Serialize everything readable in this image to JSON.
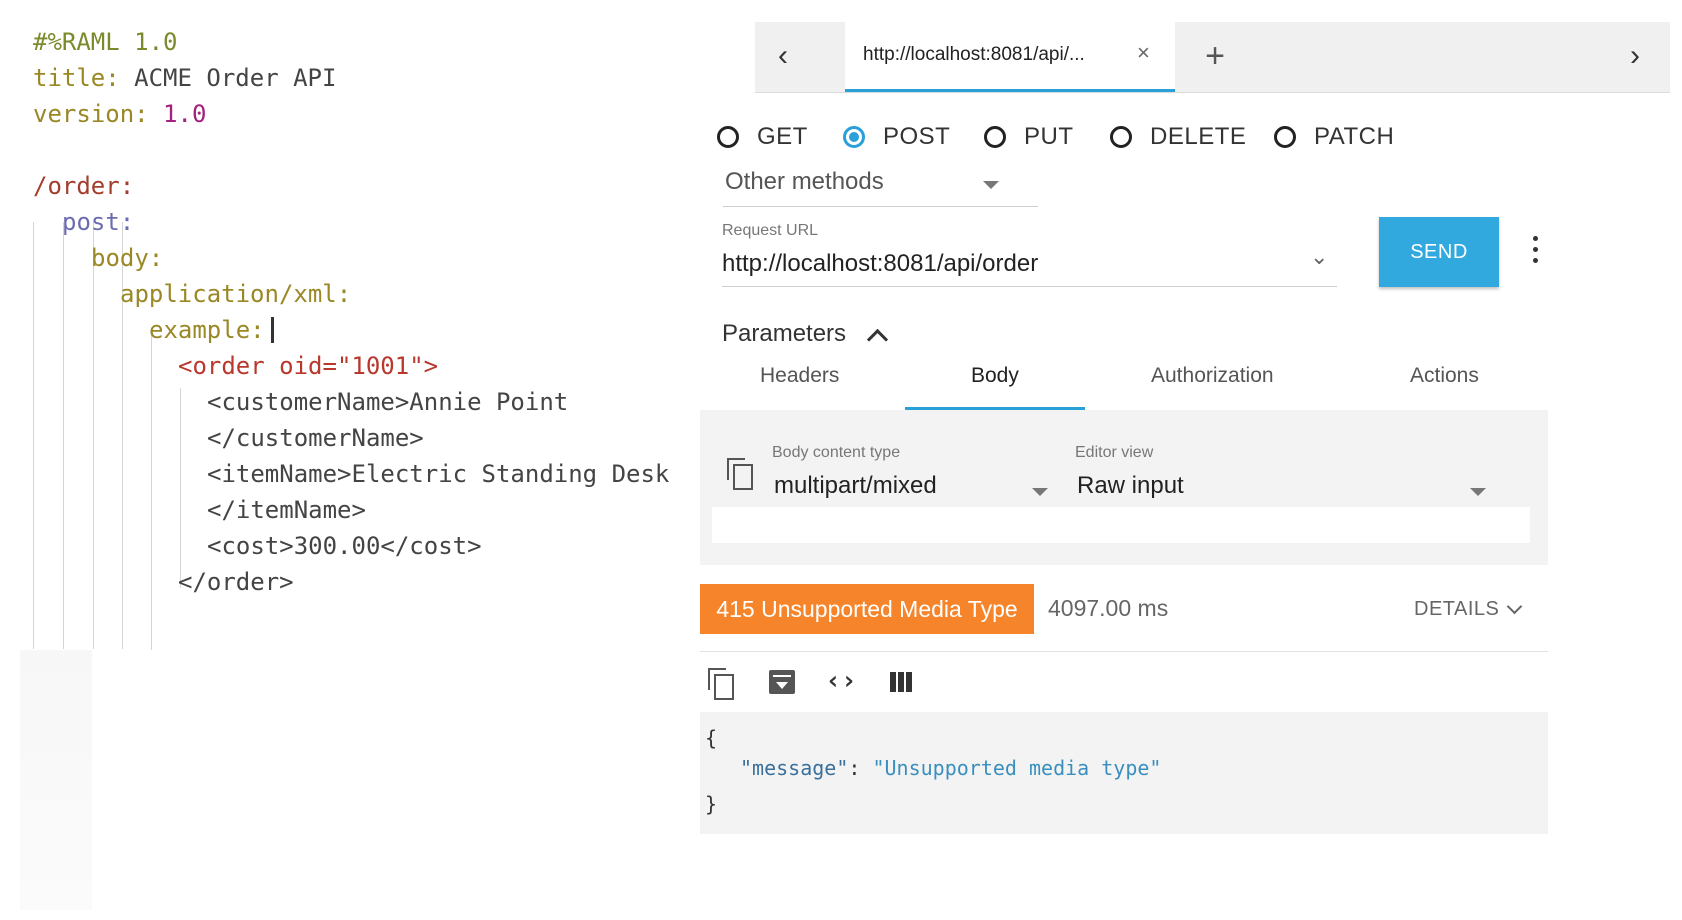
{
  "editor": {
    "header": {
      "raml": "#%RAML 1.0",
      "title_key": "title:",
      "title_val": "ACME Order API",
      "version_key": "version:",
      "version_val": "1.0"
    },
    "resource": "/order:",
    "method": "post:",
    "body_key": "body:",
    "media_type": "application/xml:",
    "example_key": "example:",
    "xml": {
      "order_open": "<order oid=\"1001\">",
      "customer_open": "<customerName>Annie Point",
      "customer_close": "</customerName>",
      "item_open": "<itemName>Electric Standing Desk",
      "item_close": "</itemName>",
      "cost": "<cost>300.00</cost>",
      "order_close": "</order>"
    }
  },
  "console": {
    "tab": {
      "title": "http://localhost:8081/api/...",
      "close": "×"
    },
    "nav": {
      "back": "‹",
      "forward": "›",
      "add": "+"
    },
    "methods": [
      {
        "label": "GET",
        "selected": false
      },
      {
        "label": "POST",
        "selected": true
      },
      {
        "label": "PUT",
        "selected": false
      },
      {
        "label": "DELETE",
        "selected": false
      },
      {
        "label": "PATCH",
        "selected": false
      }
    ],
    "other_methods": "Other methods",
    "request_url_label": "Request URL",
    "request_url": "http://localhost:8081/api/order",
    "send_label": "SEND",
    "parameters_label": "Parameters",
    "subtabs": [
      "Headers",
      "Body",
      "Authorization",
      "Actions"
    ],
    "active_subtab": "Body",
    "body_content_type_label": "Body content type",
    "body_content_type": "multipart/mixed",
    "editor_view_label": "Editor view",
    "editor_view": "Raw input",
    "response": {
      "status": "415 Unsupported Media Type",
      "time": "4097.00 ms",
      "details": "DETAILS",
      "status_color": "#f5842a",
      "json_open": "{",
      "json_key": "\"message\"",
      "json_sep": ": ",
      "json_value": "\"Unsupported media type\"",
      "json_close": "}"
    },
    "accent_color": "#2aa0d8",
    "send_color": "#31a9df"
  }
}
